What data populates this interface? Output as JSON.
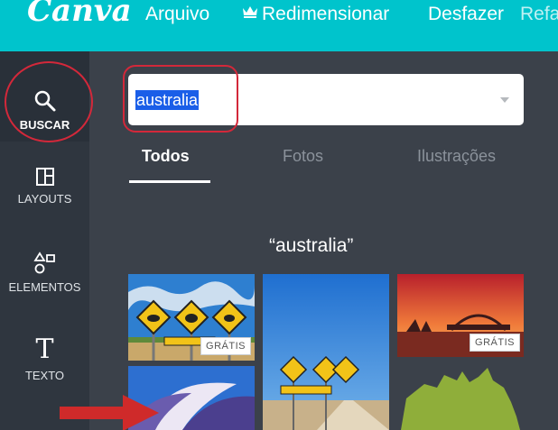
{
  "topbar": {
    "logo": "Canva",
    "menu": [
      "Arquivo",
      "Redimensionar",
      "Desfazer",
      "Refa"
    ]
  },
  "sidebar": {
    "items": [
      {
        "label": "BUSCAR",
        "icon": "search-icon"
      },
      {
        "label": "LAYOUTS",
        "icon": "layout-icon"
      },
      {
        "label": "ELEMENTOS",
        "icon": "shapes-icon"
      },
      {
        "label": "TEXTO",
        "icon": "text-icon"
      }
    ]
  },
  "search": {
    "value": "australia"
  },
  "tabs": [
    "Todos",
    "Fotos",
    "Ilustrações"
  ],
  "results": {
    "query_label": "“australia”",
    "badges": [
      "GRÁTIS",
      "GRÁTIS"
    ]
  },
  "colors": {
    "topbar": "#00c4cc",
    "sidebar": "#293039",
    "panel": "#3b414a",
    "highlight": "#d3283a"
  }
}
